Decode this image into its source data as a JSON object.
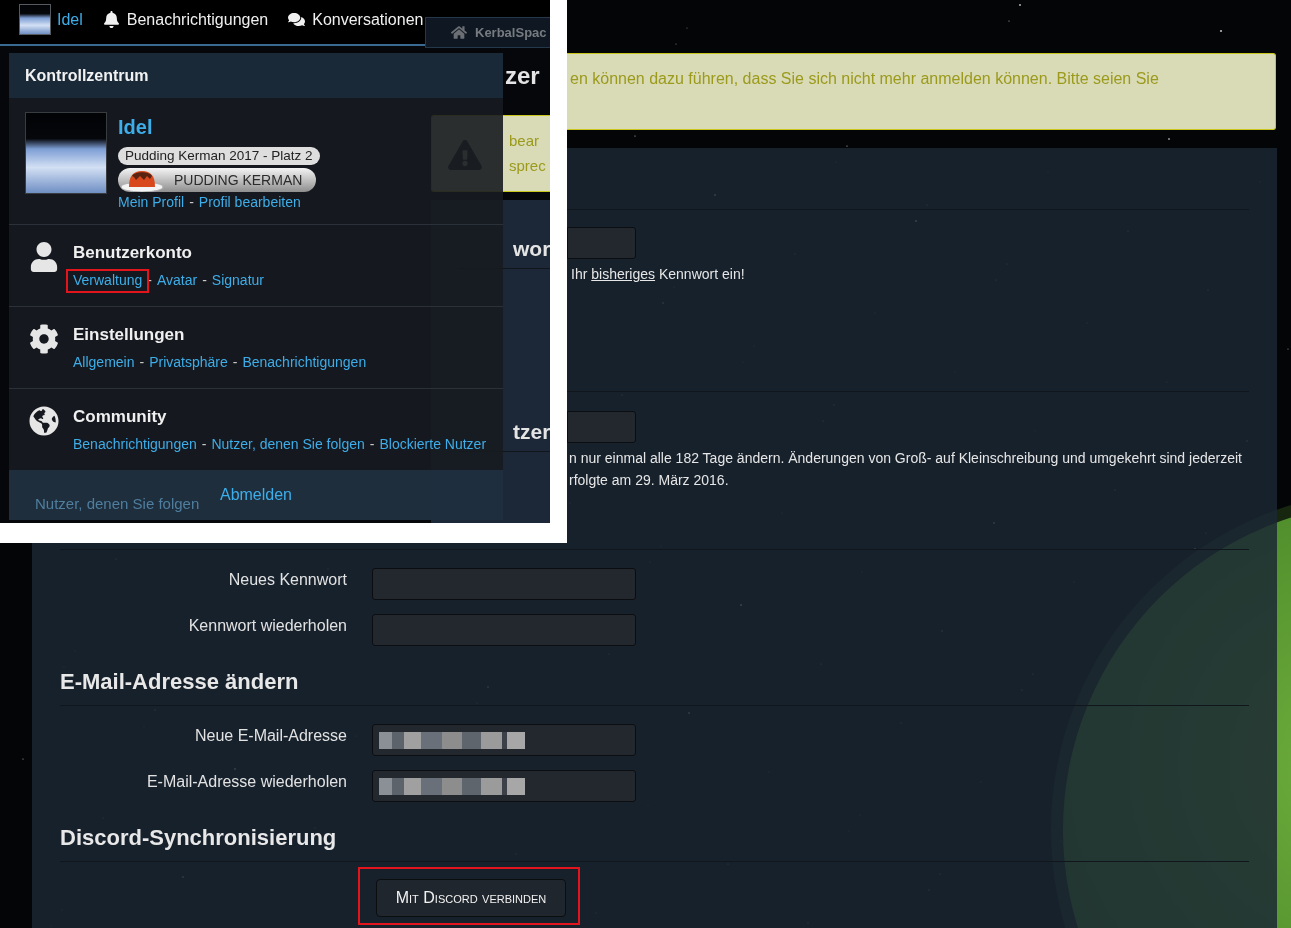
{
  "inset": {
    "header": {
      "user": "Idel",
      "items": [
        {
          "kind": "notifications",
          "label": "Benachrichtigungen"
        },
        {
          "kind": "conversations",
          "label": "Konversationen"
        }
      ],
      "breadcrumb": "KerbalSpac"
    },
    "sidebar": [
      {
        "text": "Nutzer, denen Sie folgen"
      }
    ],
    "content": {
      "title": "zer",
      "alert_lines": [
        "bear",
        "sprec"
      ],
      "headings": [
        "wor",
        "tzer"
      ]
    },
    "control_center": {
      "title": "Kontrollzentrum",
      "profile": {
        "name": "Idel",
        "badge": "Pudding Kerman 2017 - Platz 2",
        "trophy": "PUDDING KERMAN",
        "links": [
          {
            "label": "Mein Profil"
          },
          {
            "sep": "-",
            "label": "Profil bearbeiten"
          }
        ]
      },
      "sections": [
        {
          "kind": "account",
          "title": "Benutzerkonto",
          "links": [
            {
              "label": "Verwaltung",
              "highlighted": true
            },
            {
              "sep": "-",
              "label": "Avatar",
              "highlighted": false
            },
            {
              "sep": "-",
              "label": "Signatur",
              "highlighted": false
            }
          ]
        },
        {
          "kind": "settings",
          "title": "Einstellungen",
          "links": [
            {
              "label": "Allgemein",
              "highlighted": false
            },
            {
              "sep": "-",
              "label": "Privatsphäre",
              "highlighted": false
            },
            {
              "sep": "-",
              "label": "Benachrichtigungen",
              "highlighted": false
            }
          ]
        },
        {
          "kind": "community",
          "title": "Community",
          "links": [
            {
              "label": "Benachrichtigungen",
              "highlighted": false
            },
            {
              "sep": "-",
              "label": "Nutzer, denen Sie folgen",
              "highlighted": false
            },
            {
              "sep": "-",
              "label": "Blockierte Nutzer",
              "highlighted": false
            }
          ]
        }
      ],
      "logout": "Abmelden"
    }
  },
  "page": {
    "alert": "en können dazu führen, dass Sie sich nicht mehr anmelden können. Bitte seien Sie",
    "current_password": {
      "hint": [
        {
          "text": "Ihr ",
          "underline": false
        },
        {
          "text": "bisheriges",
          "underline": true
        },
        {
          "text": " Kennwort ein!",
          "underline": false
        }
      ]
    },
    "username": {
      "hint_lines": [
        "n nur einmal alle 182 Tage ändern. Änderungen von Groß- auf Kleinschreibung und umgekehrt sind jederzeit",
        "rfolgte am 29. März 2016."
      ]
    },
    "password_fields": [
      {
        "label": "Neues Kennwort"
      },
      {
        "label": "Kennwort wiederholen"
      }
    ],
    "email": {
      "title": "E-Mail-Adresse ändern",
      "fields": [
        {
          "label": "Neue E-Mail-Adresse",
          "redacted": true
        },
        {
          "label": "E-Mail-Adresse wiederholen",
          "redacted": true
        }
      ]
    },
    "discord": {
      "title": "Discord-Synchronisierung",
      "button": {
        "label": "Mit Discord verbinden",
        "highlighted": true
      }
    }
  }
}
